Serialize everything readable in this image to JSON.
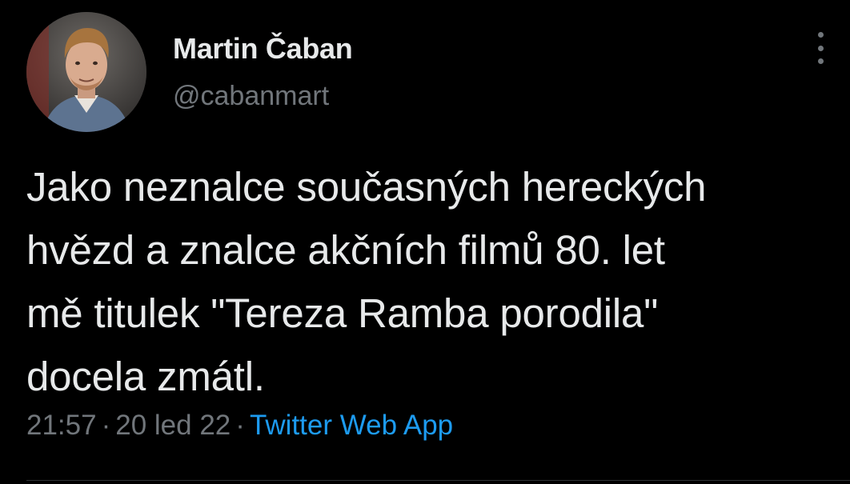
{
  "author": {
    "display_name": "Martin Čaban",
    "handle": "@cabanmart",
    "avatar_icon": "profile-photo"
  },
  "actions": {
    "more_icon": "more-vertical-icon"
  },
  "tweet": {
    "text": "Jako neznalce současných hereckých\nhvězd a znalce akčních filmů 80. let\nmě titulek \"Tereza Ramba porodila\"\ndocela zmátl.",
    "time": "21:57",
    "date": "20 led 22",
    "separator": "·",
    "source": "Twitter Web App"
  },
  "colors": {
    "background": "#000000",
    "primary_text": "#e7e9ea",
    "secondary_text": "#71767b",
    "link": "#1d9bf0"
  }
}
